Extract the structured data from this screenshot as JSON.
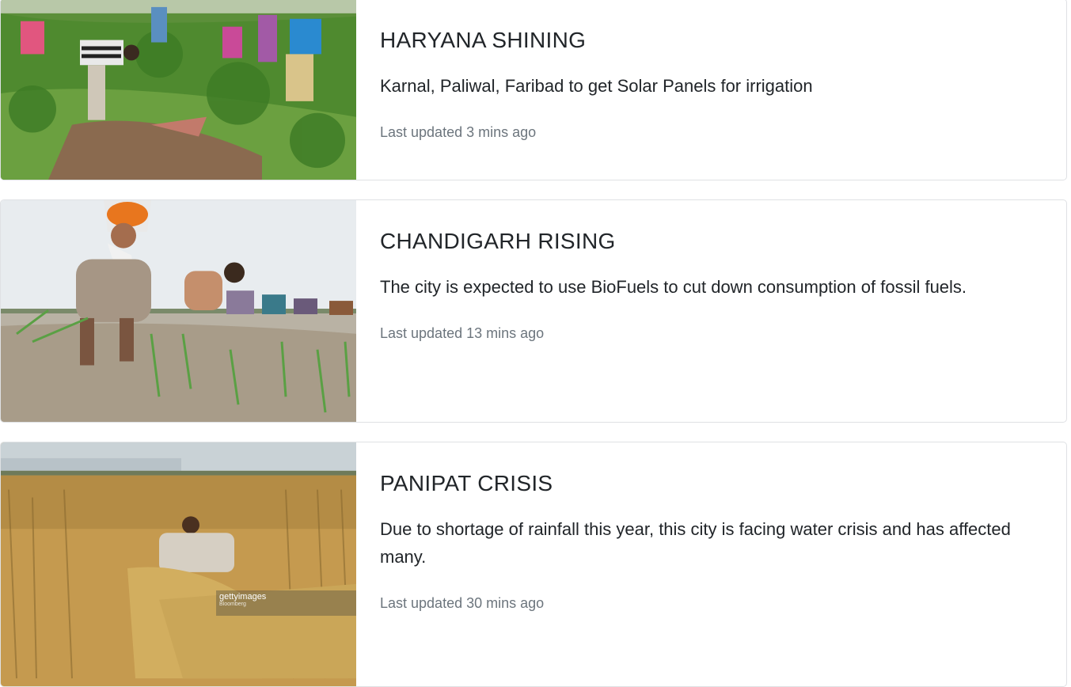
{
  "articles": [
    {
      "title": "HARYANA SHINING",
      "text": "Karnal, Paliwal, Faribad to get Solar Panels for irrigation",
      "meta": "Last updated 3 mins ago",
      "image_alt": "farm workers harvesting carrots"
    },
    {
      "title": "CHANDIGARH RISING",
      "text": "The city is expected to use BioFuels to cut down consumption of fossil fuels.",
      "meta": "Last updated 13 mins ago",
      "image_alt": "farmers planting rice seedlings in flooded field"
    },
    {
      "title": "PANIPAT CRISIS",
      "text": "Due to shortage of rainfall this year, this city is facing water crisis and has affected many.",
      "meta": "Last updated 30 mins ago",
      "image_alt": "farmer harvesting wheat",
      "watermark": "gettyimages",
      "watermark_sub": "Bloomberg"
    }
  ]
}
